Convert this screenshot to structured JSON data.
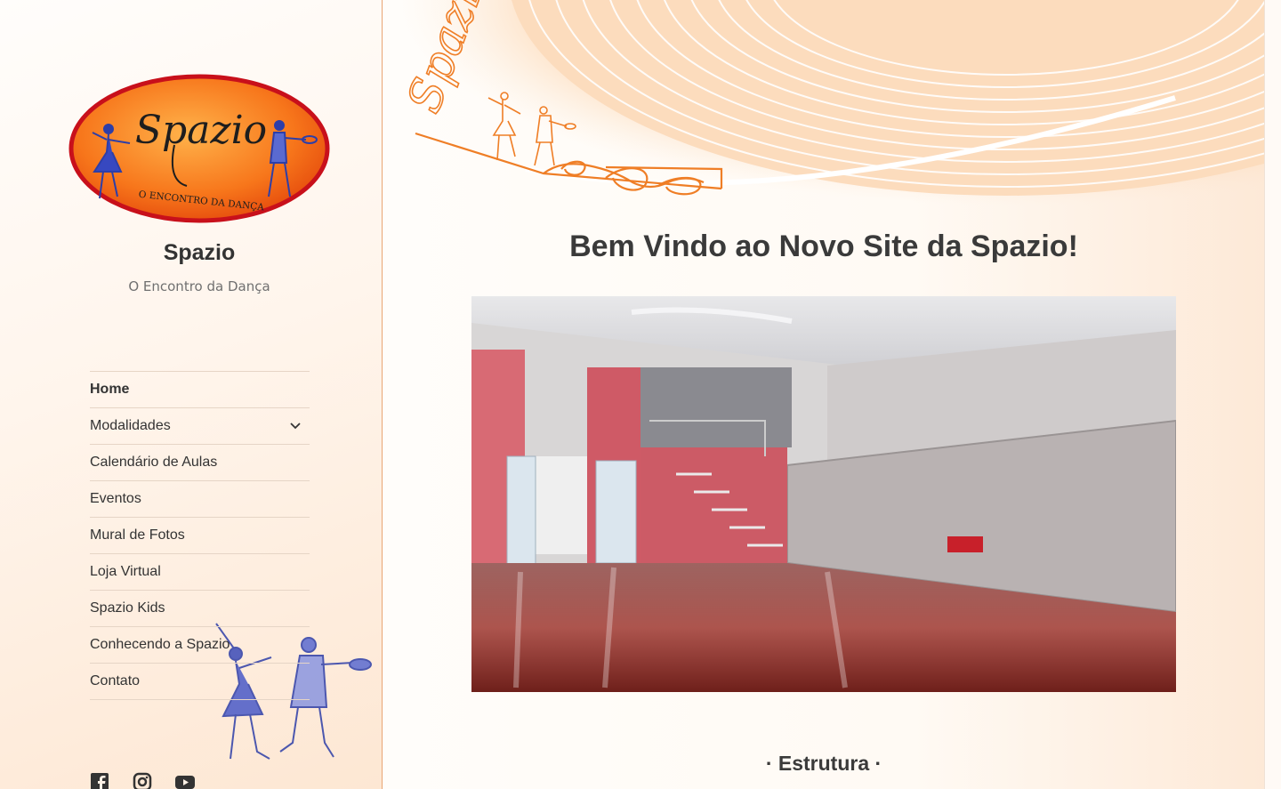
{
  "site": {
    "title": "Spazio",
    "description": "O Encontro da Dança",
    "logo_text": "Spazio",
    "logo_tagline": "O ENCONTRO DA DANÇA"
  },
  "nav": {
    "items": [
      {
        "label": "Home",
        "current": true
      },
      {
        "label": "Modalidades",
        "has_submenu": true
      },
      {
        "label": "Calendário de Aulas"
      },
      {
        "label": "Eventos"
      },
      {
        "label": "Mural de Fotos"
      },
      {
        "label": "Loja Virtual"
      },
      {
        "label": "Spazio Kids"
      },
      {
        "label": "Conhecendo a Spazio"
      },
      {
        "label": "Contato"
      }
    ]
  },
  "social": [
    "facebook-icon",
    "instagram-icon",
    "youtube-icon"
  ],
  "main": {
    "page_title": "Bem Vindo ao Novo Site da Spazio!",
    "header_signature": "Spazio",
    "section_title": "· Estrutura ·"
  },
  "colors": {
    "accent_orange": "#f07a1c",
    "logo_red": "#c8101b",
    "dancer_blue": "#2d3ea8",
    "text_dark": "#333333"
  }
}
